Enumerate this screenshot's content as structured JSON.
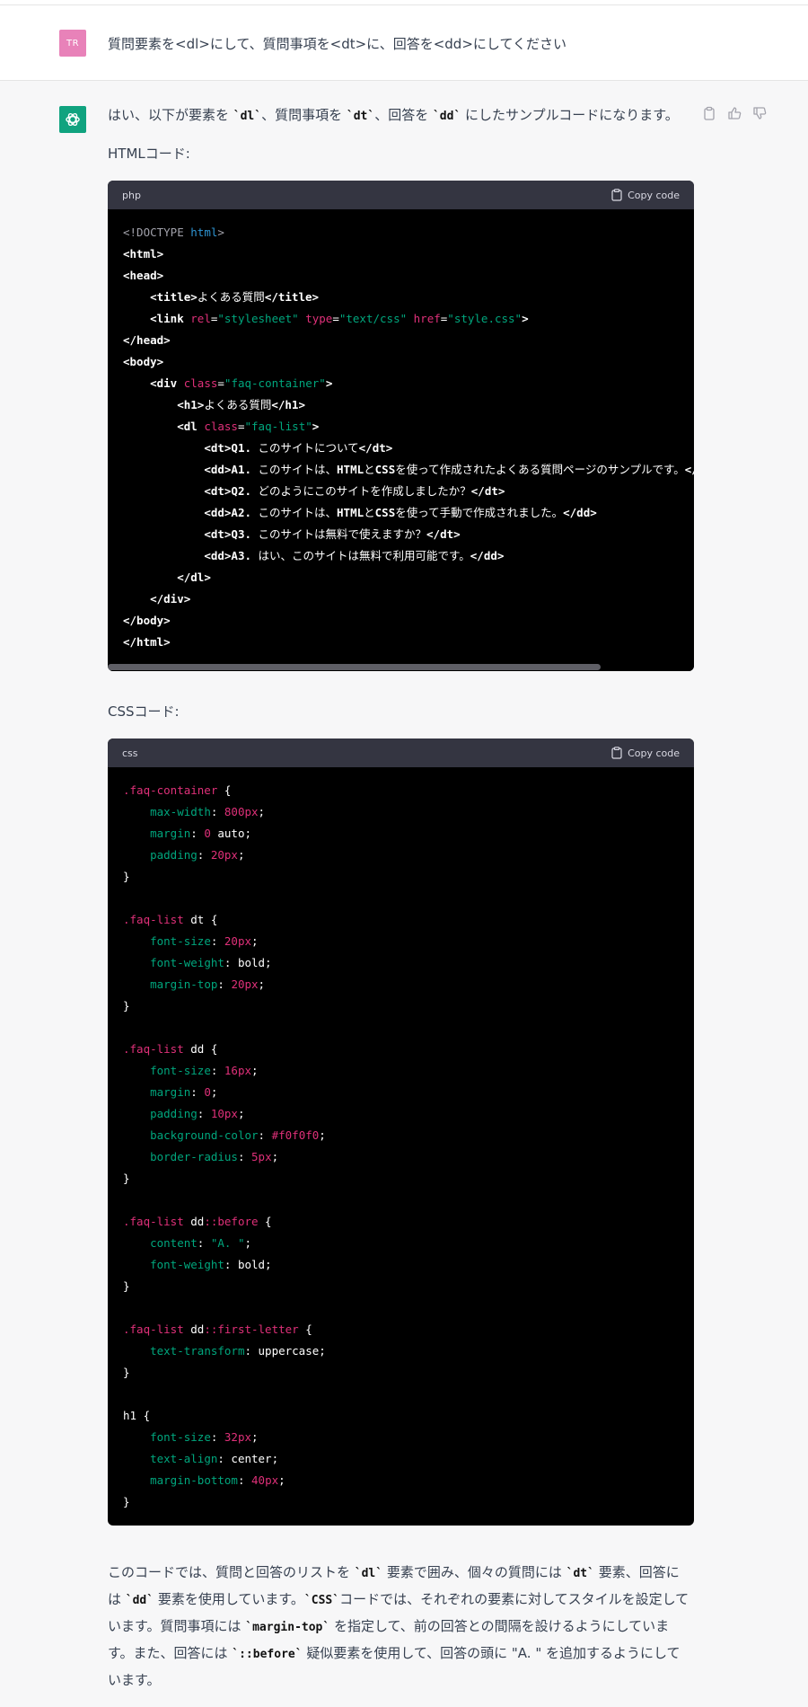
{
  "user": {
    "avatar_initials": "TR",
    "message": "質問要素を<dl>にして、質問事項を<dt>に、回答を<dd>にしてください"
  },
  "assistant": {
    "intro_before_dl": "はい、以下が要素を ",
    "intro_dl": "`dl`",
    "intro_mid1": "、質問事項を ",
    "intro_dt": "`dt`",
    "intro_mid2": "、回答を ",
    "intro_dd": "`dd`",
    "intro_after": " にしたサンプルコードになります。",
    "html_label": "HTMLコード:",
    "css_label": "CSSコード:",
    "summary": {
      "p1": "このコードでは、質問と回答のリストを ",
      "c1": "`dl`",
      "p2": " 要素で囲み、個々の質問には ",
      "c2": "`dt`",
      "p3": " 要素、回答には ",
      "c3": "`dd`",
      "p4": " 要素を使用しています。",
      "c4": "`CSS`",
      "p5": "コードでは、それぞれの要素に対してスタイルを設定しています。質問事項には ",
      "c5": "`margin-top`",
      "p6": " を指定して、前の回答との間隔を設けるようにしています。また、回答には ",
      "c6": "`::before`",
      "p7": " 疑似要素を使用して、回答の頭に \"A. \" を追加するようにしています。"
    }
  },
  "html_block": {
    "lang": "php",
    "copy_label": "Copy code",
    "lines": [
      [
        [
          "com",
          "<!DOCTYPE "
        ],
        [
          "kw",
          "html"
        ],
        [
          "com",
          ">"
        ]
      ],
      [
        [
          "tag",
          "<html>"
        ]
      ],
      [
        [
          "tag",
          "<head>"
        ]
      ],
      [
        [
          "plain",
          "    "
        ],
        [
          "tag",
          "<title>"
        ],
        [
          "plain",
          "よくある質問"
        ],
        [
          "tag",
          "</title>"
        ]
      ],
      [
        [
          "plain",
          "    "
        ],
        [
          "tag",
          "<link "
        ],
        [
          "attr",
          "rel"
        ],
        [
          "plain",
          "="
        ],
        [
          "str",
          "\"stylesheet\""
        ],
        [
          "plain",
          " "
        ],
        [
          "attr",
          "type"
        ],
        [
          "plain",
          "="
        ],
        [
          "str",
          "\"text/css\""
        ],
        [
          "plain",
          " "
        ],
        [
          "attr",
          "href"
        ],
        [
          "plain",
          "="
        ],
        [
          "str",
          "\"style.css\""
        ],
        [
          "tag",
          ">"
        ]
      ],
      [
        [
          "tag",
          "</head>"
        ]
      ],
      [
        [
          "tag",
          "<body>"
        ]
      ],
      [
        [
          "plain",
          "    "
        ],
        [
          "tag",
          "<div "
        ],
        [
          "attr",
          "class"
        ],
        [
          "plain",
          "="
        ],
        [
          "str",
          "\"faq-container\""
        ],
        [
          "tag",
          ">"
        ]
      ],
      [
        [
          "plain",
          "        "
        ],
        [
          "tag",
          "<h1>"
        ],
        [
          "plain",
          "よくある質問"
        ],
        [
          "tag",
          "</h1>"
        ]
      ],
      [
        [
          "plain",
          "        "
        ],
        [
          "tag",
          "<dl "
        ],
        [
          "attr",
          "class"
        ],
        [
          "plain",
          "="
        ],
        [
          "str",
          "\"faq-list\""
        ],
        [
          "tag",
          ">"
        ]
      ],
      [
        [
          "plain",
          "            "
        ],
        [
          "tag",
          "<dt>"
        ],
        [
          "tag",
          "Q1."
        ],
        [
          "plain",
          " このサイトについて"
        ],
        [
          "tag",
          "</dt>"
        ]
      ],
      [
        [
          "plain",
          "            "
        ],
        [
          "tag",
          "<dd>"
        ],
        [
          "tag",
          "A1."
        ],
        [
          "plain",
          " このサイトは、"
        ],
        [
          "tag",
          "HTML"
        ],
        [
          "plain",
          "と"
        ],
        [
          "tag",
          "CSS"
        ],
        [
          "plain",
          "を使って作成されたよくある質問ページのサンプルです。"
        ],
        [
          "tag",
          "</dd>"
        ]
      ],
      [
        [
          "plain",
          "            "
        ],
        [
          "tag",
          "<dt>"
        ],
        [
          "tag",
          "Q2."
        ],
        [
          "plain",
          " どのようにこのサイトを作成しましたか？"
        ],
        [
          "tag",
          "</dt>"
        ]
      ],
      [
        [
          "plain",
          "            "
        ],
        [
          "tag",
          "<dd>"
        ],
        [
          "tag",
          "A2."
        ],
        [
          "plain",
          " このサイトは、"
        ],
        [
          "tag",
          "HTML"
        ],
        [
          "plain",
          "と"
        ],
        [
          "tag",
          "CSS"
        ],
        [
          "plain",
          "を使って手動で作成されました。"
        ],
        [
          "tag",
          "</dd>"
        ]
      ],
      [
        [
          "plain",
          "            "
        ],
        [
          "tag",
          "<dt>"
        ],
        [
          "tag",
          "Q3."
        ],
        [
          "plain",
          " このサイトは無料で使えますか？"
        ],
        [
          "tag",
          "</dt>"
        ]
      ],
      [
        [
          "plain",
          "            "
        ],
        [
          "tag",
          "<dd>"
        ],
        [
          "tag",
          "A3."
        ],
        [
          "plain",
          " はい、このサイトは無料で利用可能です。"
        ],
        [
          "tag",
          "</dd>"
        ]
      ],
      [
        [
          "plain",
          "        "
        ],
        [
          "tag",
          "</dl>"
        ]
      ],
      [
        [
          "plain",
          "    "
        ],
        [
          "tag",
          "</div>"
        ]
      ],
      [
        [
          "tag",
          "</body>"
        ]
      ],
      [
        [
          "tag",
          "</html>"
        ]
      ]
    ]
  },
  "css_block": {
    "lang": "css",
    "copy_label": "Copy code",
    "lines": [
      [
        [
          "sel",
          ".faq-container"
        ],
        [
          "plain",
          " {"
        ]
      ],
      [
        [
          "plain",
          "    "
        ],
        [
          "prop",
          "max-width"
        ],
        [
          "plain",
          ": "
        ],
        [
          "num",
          "800px"
        ],
        [
          "plain",
          ";"
        ]
      ],
      [
        [
          "plain",
          "    "
        ],
        [
          "prop",
          "margin"
        ],
        [
          "plain",
          ": "
        ],
        [
          "num",
          "0"
        ],
        [
          "plain",
          " auto;"
        ]
      ],
      [
        [
          "plain",
          "    "
        ],
        [
          "prop",
          "padding"
        ],
        [
          "plain",
          ": "
        ],
        [
          "num",
          "20px"
        ],
        [
          "plain",
          ";"
        ]
      ],
      [
        [
          "plain",
          "}"
        ]
      ],
      [
        [
          "plain",
          ""
        ]
      ],
      [
        [
          "sel",
          ".faq-list"
        ],
        [
          "plain",
          " dt {"
        ]
      ],
      [
        [
          "plain",
          "    "
        ],
        [
          "prop",
          "font-size"
        ],
        [
          "plain",
          ": "
        ],
        [
          "num",
          "20px"
        ],
        [
          "plain",
          ";"
        ]
      ],
      [
        [
          "plain",
          "    "
        ],
        [
          "prop",
          "font-weight"
        ],
        [
          "plain",
          ": bold;"
        ]
      ],
      [
        [
          "plain",
          "    "
        ],
        [
          "prop",
          "margin-top"
        ],
        [
          "plain",
          ": "
        ],
        [
          "num",
          "20px"
        ],
        [
          "plain",
          ";"
        ]
      ],
      [
        [
          "plain",
          "}"
        ]
      ],
      [
        [
          "plain",
          ""
        ]
      ],
      [
        [
          "sel",
          ".faq-list"
        ],
        [
          "plain",
          " dd {"
        ]
      ],
      [
        [
          "plain",
          "    "
        ],
        [
          "prop",
          "font-size"
        ],
        [
          "plain",
          ": "
        ],
        [
          "num",
          "16px"
        ],
        [
          "plain",
          ";"
        ]
      ],
      [
        [
          "plain",
          "    "
        ],
        [
          "prop",
          "margin"
        ],
        [
          "plain",
          ": "
        ],
        [
          "num",
          "0"
        ],
        [
          "plain",
          ";"
        ]
      ],
      [
        [
          "plain",
          "    "
        ],
        [
          "prop",
          "padding"
        ],
        [
          "plain",
          ": "
        ],
        [
          "num",
          "10px"
        ],
        [
          "plain",
          ";"
        ]
      ],
      [
        [
          "plain",
          "    "
        ],
        [
          "prop",
          "background-color"
        ],
        [
          "plain",
          ": "
        ],
        [
          "num",
          "#f0f0f0"
        ],
        [
          "plain",
          ";"
        ]
      ],
      [
        [
          "plain",
          "    "
        ],
        [
          "prop",
          "border-radius"
        ],
        [
          "plain",
          ": "
        ],
        [
          "num",
          "5px"
        ],
        [
          "plain",
          ";"
        ]
      ],
      [
        [
          "plain",
          "}"
        ]
      ],
      [
        [
          "plain",
          ""
        ]
      ],
      [
        [
          "sel",
          ".faq-list"
        ],
        [
          "plain",
          " dd"
        ],
        [
          "sel",
          "::before"
        ],
        [
          "plain",
          " {"
        ]
      ],
      [
        [
          "plain",
          "    "
        ],
        [
          "prop",
          "content"
        ],
        [
          "plain",
          ": "
        ],
        [
          "str",
          "\"A. \""
        ],
        [
          "plain",
          ";"
        ]
      ],
      [
        [
          "plain",
          "    "
        ],
        [
          "prop",
          "font-weight"
        ],
        [
          "plain",
          ": bold;"
        ]
      ],
      [
        [
          "plain",
          "}"
        ]
      ],
      [
        [
          "plain",
          ""
        ]
      ],
      [
        [
          "sel",
          ".faq-list"
        ],
        [
          "plain",
          " dd"
        ],
        [
          "sel",
          "::first-letter"
        ],
        [
          "plain",
          " {"
        ]
      ],
      [
        [
          "plain",
          "    "
        ],
        [
          "prop",
          "text-transform"
        ],
        [
          "plain",
          ": uppercase;"
        ]
      ],
      [
        [
          "plain",
          "}"
        ]
      ],
      [
        [
          "plain",
          ""
        ]
      ],
      [
        [
          "plain",
          "h1 {"
        ]
      ],
      [
        [
          "plain",
          "    "
        ],
        [
          "prop",
          "font-size"
        ],
        [
          "plain",
          ": "
        ],
        [
          "num",
          "32px"
        ],
        [
          "plain",
          ";"
        ]
      ],
      [
        [
          "plain",
          "    "
        ],
        [
          "prop",
          "text-align"
        ],
        [
          "plain",
          ": center;"
        ]
      ],
      [
        [
          "plain",
          "    "
        ],
        [
          "prop",
          "margin-bottom"
        ],
        [
          "plain",
          ": "
        ],
        [
          "num",
          "40px"
        ],
        [
          "plain",
          ";"
        ]
      ],
      [
        [
          "plain",
          "}"
        ]
      ]
    ]
  }
}
